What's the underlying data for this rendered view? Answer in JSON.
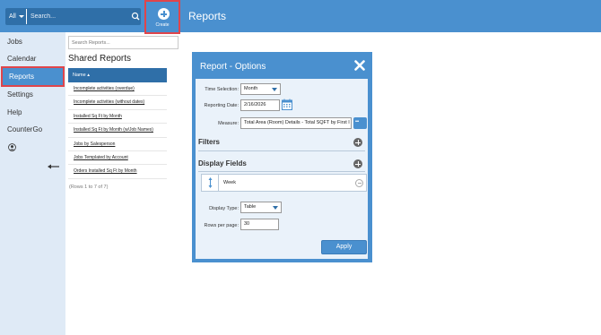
{
  "topbar": {
    "search_scope": "All",
    "search_placeholder": "Search...",
    "create_label": "Create",
    "page_title": "Reports"
  },
  "sidebar": {
    "items": [
      {
        "label": "Jobs"
      },
      {
        "label": "Calendar"
      },
      {
        "label": "Reports",
        "active": true
      },
      {
        "label": "Settings"
      },
      {
        "label": "Help"
      },
      {
        "label": "CounterGo"
      }
    ]
  },
  "reports_panel": {
    "search_placeholder": "Search Reports...",
    "title": "Shared Reports",
    "column_header": "Name ▴",
    "rows": [
      "Incomplete activities (overdue)",
      "Incomplete activities (without dates)",
      "Installed Sq Ft by Month",
      "Installed Sq Ft by Month (w/Job Names)",
      "Jobs by Salesperson",
      "Jobs Templated by Account",
      "Orders Installed Sq Ft by Month"
    ],
    "rows_info": "(Rows 1 to 7 of 7)"
  },
  "modal": {
    "title": "Report - Options",
    "time_selection_label": "Time Selection:",
    "time_selection_value": "Month",
    "reporting_date_label": "Reporting Date:",
    "reporting_date_value": "2/16/2026",
    "measure_label": "Measure:",
    "measure_value": "Total Area (Room) Details - Total SQFT by First I",
    "filters_title": "Filters",
    "display_fields_title": "Display Fields",
    "display_field_item": "Week",
    "display_type_label": "Display Type:",
    "display_type_value": "Table",
    "rows_per_page_label": "Rows per page:",
    "rows_per_page_value": "30",
    "apply_label": "Apply"
  },
  "colors": {
    "primary": "#4a90cf",
    "primary_dark": "#2f6fa8",
    "highlight": "#e0454b",
    "sidebar_bg": "#dfeaf6",
    "modal_body": "#eaf2fa"
  }
}
